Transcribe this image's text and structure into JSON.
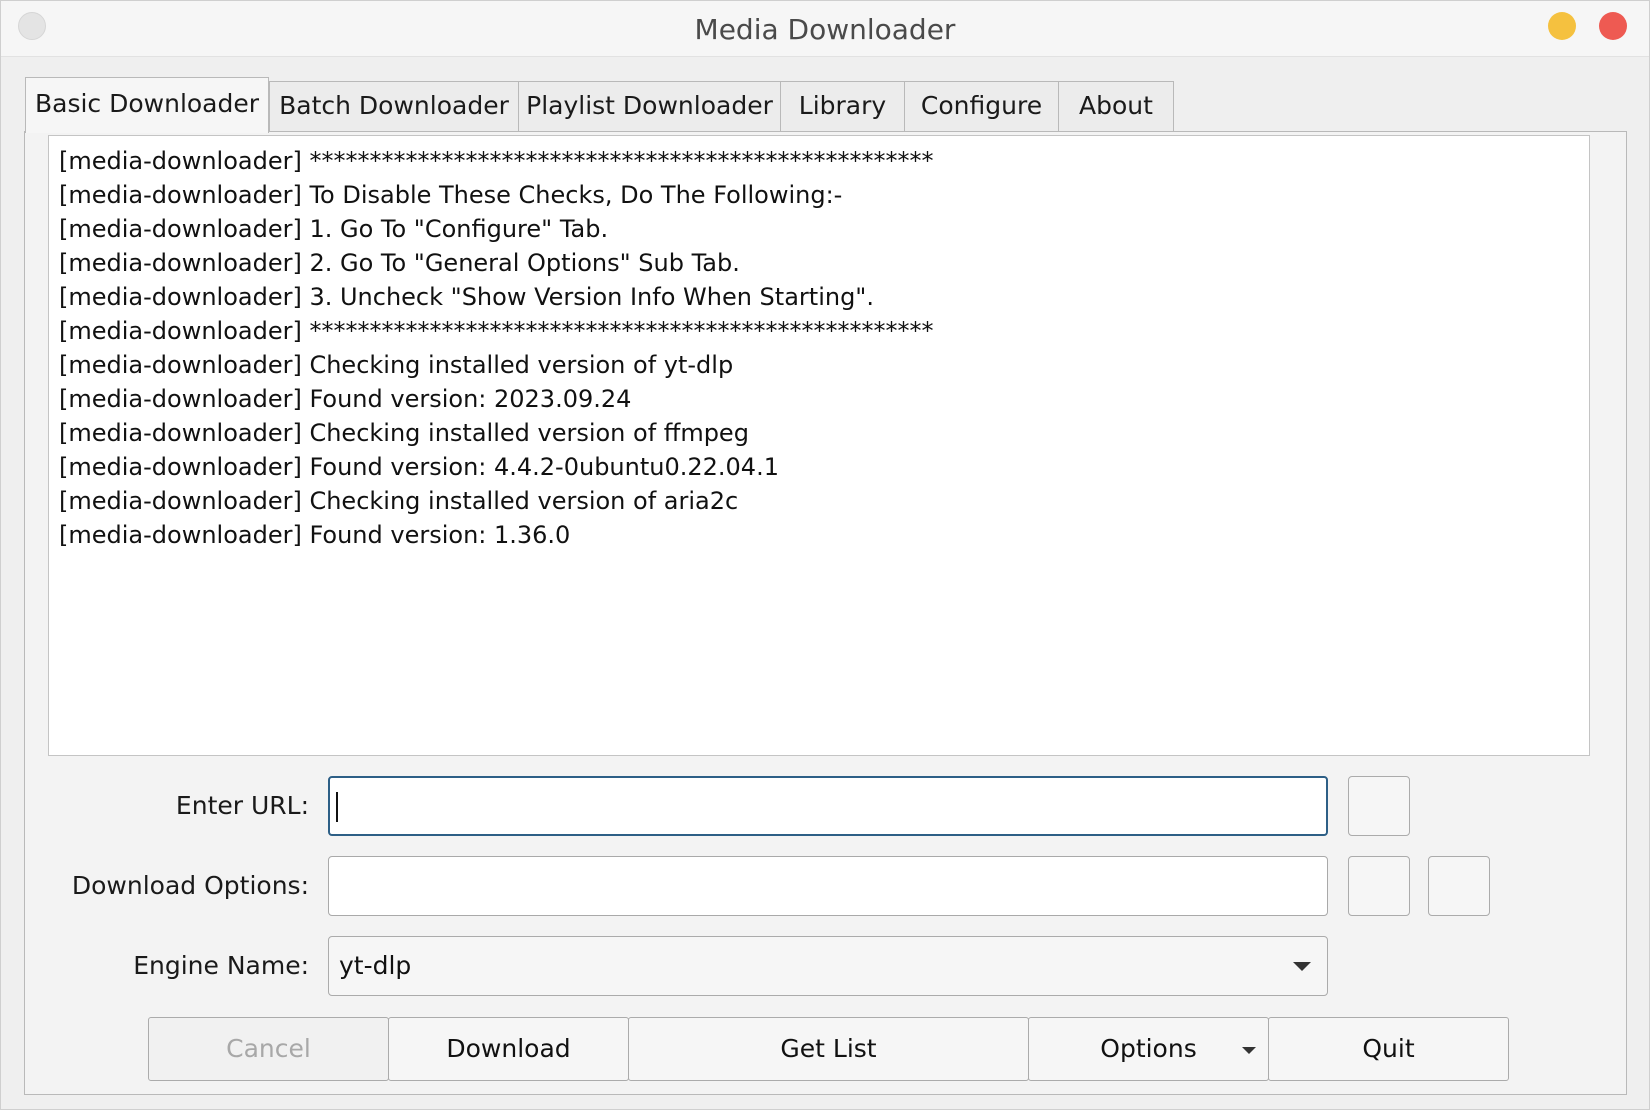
{
  "window": {
    "title": "Media Downloader"
  },
  "tabs": [
    {
      "label": "Basic Downloader",
      "active": true
    },
    {
      "label": "Batch Downloader",
      "active": false
    },
    {
      "label": "Playlist Downloader",
      "active": false
    },
    {
      "label": "Library",
      "active": false
    },
    {
      "label": "Configure",
      "active": false
    },
    {
      "label": "About",
      "active": false
    }
  ],
  "log": {
    "lines": [
      "[media-downloader] ****************************************************",
      "[media-downloader] To Disable These Checks, Do The Following:-",
      "[media-downloader] 1. Go To \"Configure\" Tab.",
      "[media-downloader] 2. Go To \"General Options\" Sub Tab.",
      "[media-downloader] 3. Uncheck \"Show Version Info When Starting\".",
      "[media-downloader] ****************************************************",
      "[media-downloader] Checking installed version of yt-dlp",
      "[media-downloader] Found version: 2023.09.24",
      "[media-downloader] Checking installed version of ffmpeg",
      "[media-downloader] Found version: 4.4.2-0ubuntu0.22.04.1",
      "[media-downloader] Checking installed version of aria2c",
      "[media-downloader] Found version: 1.36.0"
    ]
  },
  "form": {
    "url_label": "Enter URL:",
    "url_value": "",
    "options_label": "Download Options:",
    "options_value": "",
    "engine_label": "Engine Name:",
    "engine_value": "yt-dlp"
  },
  "buttons": {
    "cancel": "Cancel",
    "download": "Download",
    "get_list": "Get List",
    "options": "Options",
    "quit": "Quit"
  },
  "colors": {
    "close": "#ee5a52",
    "minimize": "#f5c13f",
    "focus_border": "#2d5f86"
  }
}
